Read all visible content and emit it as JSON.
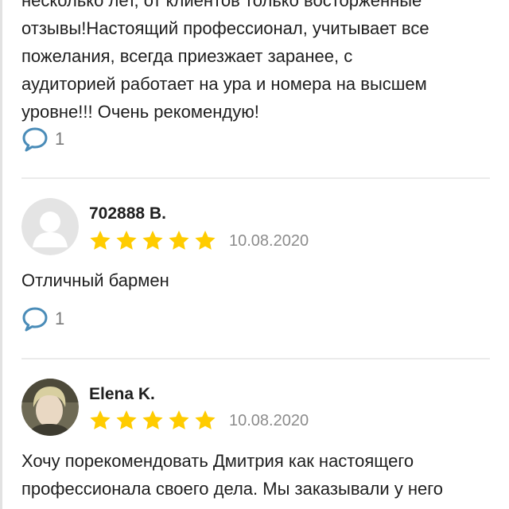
{
  "reviews": [
    {
      "text": "несколько лет, от клиентов только восторженные\nотзывы!Настоящий профессионал, учитывает все\nпожелания, всегда приезжает заранее, с\nаудиторией работает на ура и номера на высшем\nуровне!!! Очень рекомендую!",
      "comment_count": "1"
    },
    {
      "author": "702888 В.",
      "avatar": "default-user-silhouette",
      "rating": 5,
      "date": "10.08.2020",
      "text": "Отличный бармен",
      "comment_count": "1"
    },
    {
      "author": "Elena K.",
      "avatar": "user-photo",
      "rating": 5,
      "date": "10.08.2020",
      "text": "Хочу порекомендовать Дмитрия как настоящего\nпрофессионала своего дела. Мы заказывали у него\nнагулу бармен Шоу ив выездные Квесты. Очень"
    }
  ],
  "colors": {
    "star": "#ffcc00",
    "icon": "#4a8cb8",
    "date": "#8c8c8c",
    "divider": "#ebebeb"
  },
  "icons": {
    "comment": "speech-bubble-icon",
    "star": "star-icon"
  }
}
